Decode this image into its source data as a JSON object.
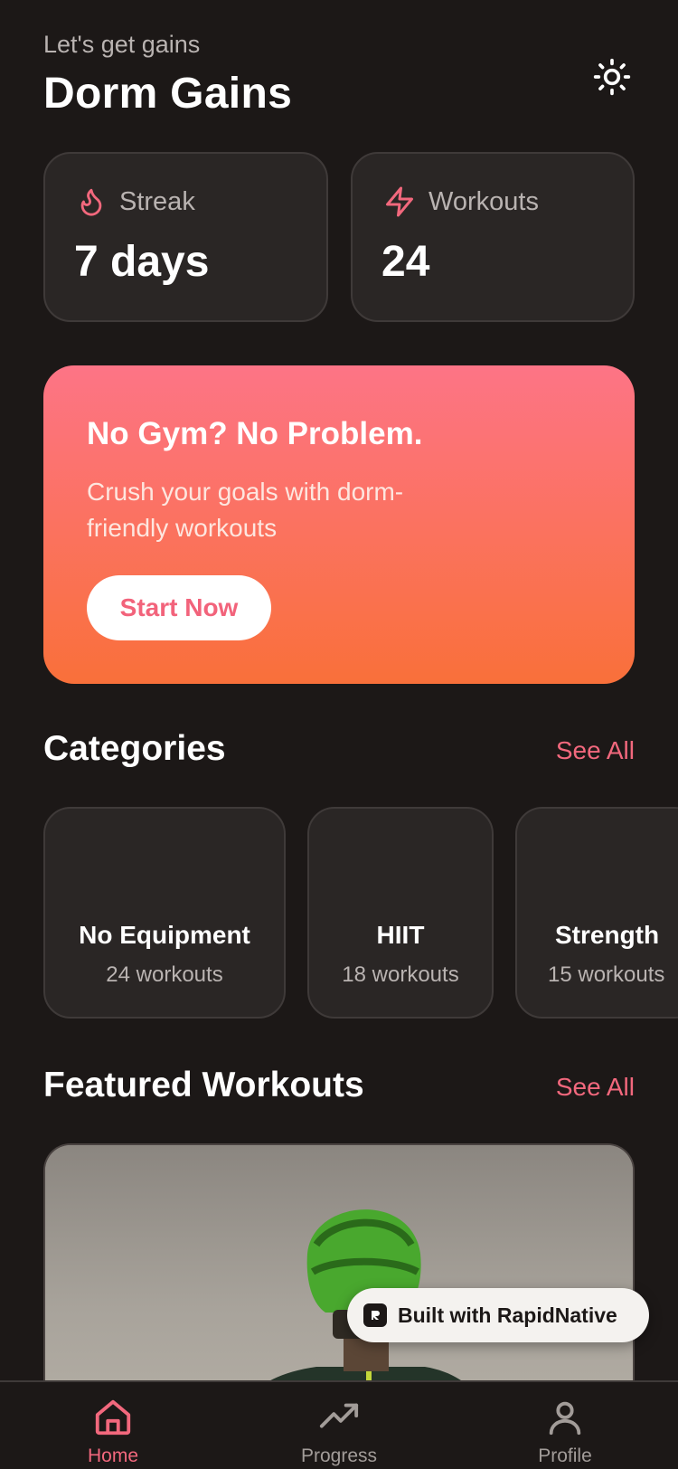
{
  "header": {
    "greeting": "Let's get gains",
    "title": "Dorm Gains",
    "theme_icon": "sun-icon"
  },
  "stats": [
    {
      "icon": "flame-icon",
      "label": "Streak",
      "value": "7 days"
    },
    {
      "icon": "lightning-icon",
      "label": "Workouts",
      "value": "24"
    }
  ],
  "hero": {
    "title": "No Gym? No Problem.",
    "subtitle": "Crush your goals with dorm-friendly workouts",
    "button": "Start Now"
  },
  "categories": {
    "title": "Categories",
    "see_all": "See All",
    "items": [
      {
        "name": "No Equipment",
        "count": "24 workouts"
      },
      {
        "name": "HIIT",
        "count": "18 workouts"
      },
      {
        "name": "Strength",
        "count": "15 workouts"
      }
    ]
  },
  "featured": {
    "title": "Featured Workouts",
    "see_all": "See All"
  },
  "badge": {
    "text": "Built with RapidNative"
  },
  "tabs": [
    {
      "icon": "home-icon",
      "label": "Home",
      "active": true
    },
    {
      "icon": "trending-up-icon",
      "label": "Progress",
      "active": false
    },
    {
      "icon": "user-icon",
      "label": "Profile",
      "active": false
    }
  ],
  "colors": {
    "accent": "#f2687d",
    "background": "#1c1817",
    "card": "#2a2625",
    "gradient_top": "#fd7486",
    "gradient_bottom": "#f9703a"
  }
}
